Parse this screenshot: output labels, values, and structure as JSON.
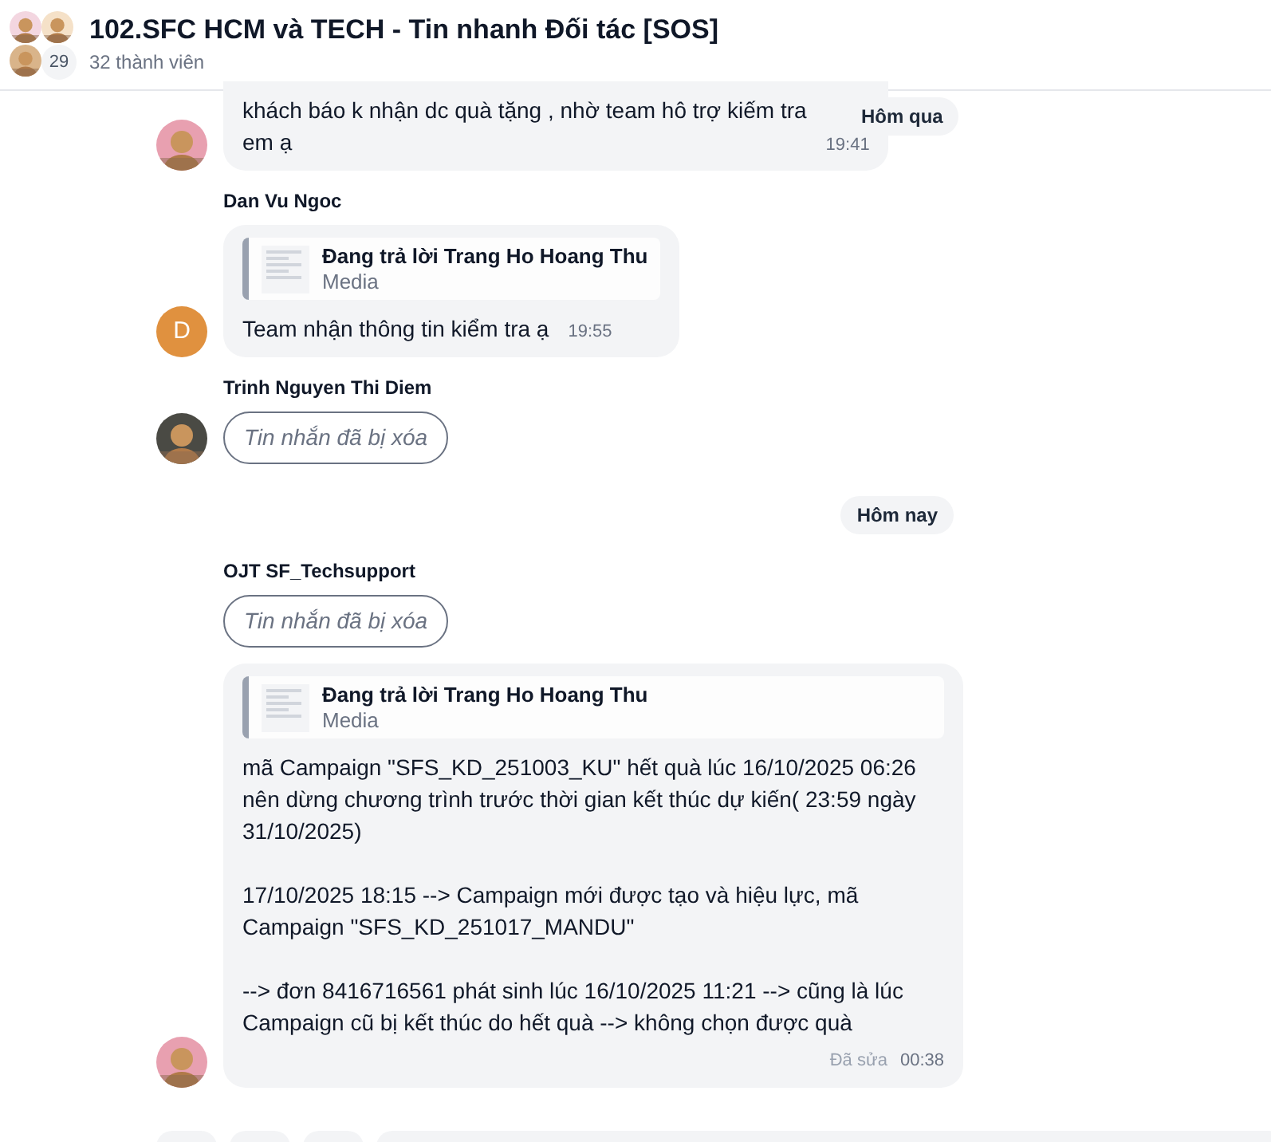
{
  "header": {
    "title": "102.SFC HCM và TECH - Tin nhanh Đối tác [SOS]",
    "members": "32 thành viên",
    "avatar_count": "29"
  },
  "messages": [
    {
      "kind": "message",
      "text": "khách báo k nhận dc quà tặng , nhờ team hô trợ kiếm tra\nem ạ",
      "time": "19:41",
      "date_badge": "Hôm qua"
    },
    {
      "kind": "message",
      "sender": "Dan Vu Ngoc",
      "avatar": {
        "kind": "letter",
        "letter": "D"
      },
      "reply": {
        "title": "Đang trả lời Trang Ho Hoang Thu",
        "subtitle": "Media"
      },
      "text": "Team nhận thông tin kiểm tra ạ",
      "time": "19:55"
    },
    {
      "kind": "deleted",
      "sender": "Trinh Nguyen Thi Diem",
      "text": "Tin nhắn đã bị xóa"
    },
    {
      "kind": "date",
      "text": "Hôm nay"
    },
    {
      "kind": "deleted",
      "sender": "OJT SF_Techsupport",
      "text": "Tin nhắn đã bị xóa"
    },
    {
      "kind": "message",
      "reply": {
        "title": "Đang trả lời Trang Ho Hoang Thu",
        "subtitle": "Media"
      },
      "text": "mã Campaign \"SFS_KD_251003_KU\" hết quà lúc 16/10/2025 06:26 nên dừng chương trình trước thời gian kết thúc dự kiến( 23:59 ngày 31/10/2025)\n\n17/10/2025 18:15 --> Campaign mới được tạo và hiệu lực, mã Campaign \"SFS_KD_251017_MANDU\"\n\n--> đơn 8416716561 phát sinh lúc 16/10/2025 11:21 --> cũng là lúc Campaign cũ bị kết thúc do hết quà --> không chọn được quà",
      "edited": "Đã sửa",
      "time": "00:38"
    }
  ]
}
